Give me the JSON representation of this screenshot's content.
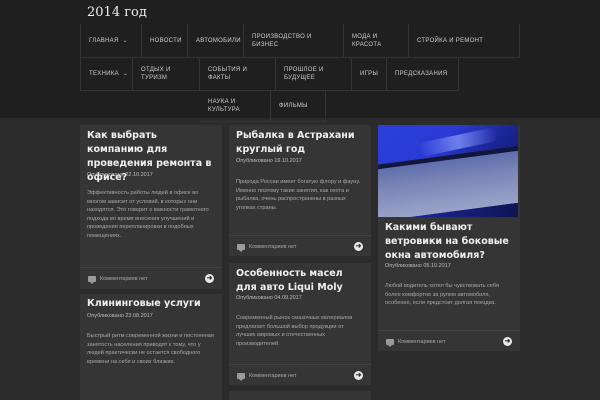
{
  "site": {
    "title": "2014 год"
  },
  "nav": {
    "row1": [
      "Главная",
      "Новости",
      "Автомобили",
      "Производство и бизнес",
      "Мода и красота",
      "Стройка и ремонт"
    ],
    "row2": [
      "Техника",
      "Отдых и туризм",
      "События и факты",
      "Прошлое и будущее",
      "Игры",
      "Предсказания"
    ],
    "row3": [
      "Наука и культура",
      "Фильмы"
    ]
  },
  "posts": [
    {
      "title": "Как выбрать компанию для проведения ремонта в офисе?",
      "date": "Опубликовано 22.10.2017",
      "excerpt": "Эффективность работы людей в офисе во многом зависит от условий, в которых они находятся. Это говорит о важности грамотного подхода во время внесения улучшений и проведения перепланировки в подобных помещениях.",
      "comments": "Комментариев нет"
    },
    {
      "title": "Клининговые услуги",
      "date": "Опубликовано 23.08.2017",
      "excerpt": "Быстрый ритм современной жизни и постоянная занятость населения приводят к тому, что у людей практически не остается свободного времени на себя и своих близких."
    },
    {
      "title": "Рыбалка в Астрахани круглый год",
      "date": "Опубликовано 19.10.2017",
      "excerpt": "Природа России имеет богатую флору и фауну. Именно поэтому такие занятия, как охота и рыбалка, очень распространены в разных уголках страны.",
      "comments": "Комментариев нет"
    },
    {
      "title": "Особенность масел для авто Liqui Moly",
      "date": "Опубликовано 04.09.2017",
      "excerpt": "Современный рынок смазочных материалов предлагает большой выбор продукции от лучших мировых и отечественных производителей.",
      "comments": "Комментариев нет"
    },
    {
      "title": "Какими бывают ветровики на боковые окна автомобиля?",
      "date": "Опубликовано 05.10.2017",
      "excerpt": "Любой водитель хотел бы чувствовать себя более комфортно за рулем автомобиля, особенно, если предстоит долгая поездка.",
      "comments": "Комментариев нет"
    }
  ],
  "icons": {
    "comment": "comment-icon",
    "more": "arrow-right-circle-icon"
  },
  "colors": {
    "background": "#2b2b2b",
    "card": "#353535",
    "header": "#1f1f1f",
    "image_accent": "#2a3ad4"
  }
}
